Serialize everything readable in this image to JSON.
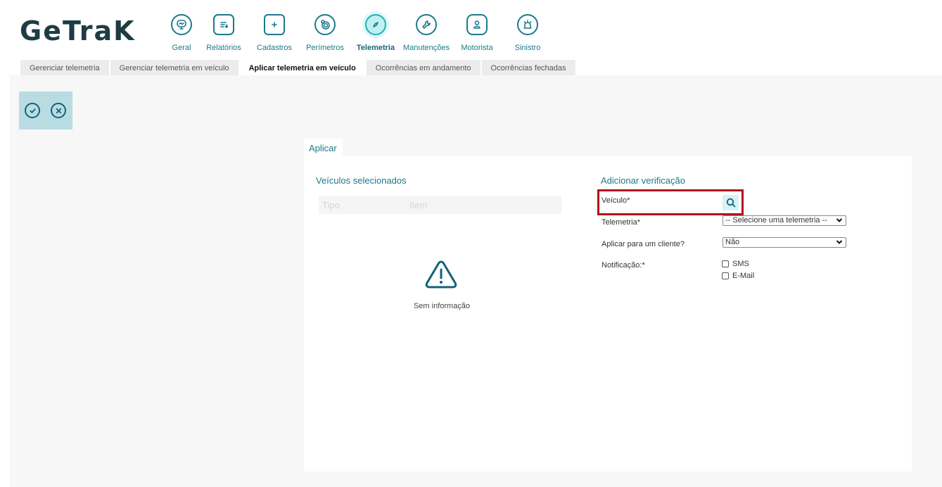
{
  "app": {
    "logo_text": "GeTraK"
  },
  "nav": {
    "items": [
      {
        "label": "Geral",
        "icon": "monitor-chart-icon"
      },
      {
        "label": "Relatórios",
        "icon": "report-list-icon"
      },
      {
        "label": "Cadastros",
        "icon": "folder-plus-icon"
      },
      {
        "label": "Perímetros",
        "icon": "target-perimeter-icon"
      },
      {
        "label": "Telemetria",
        "icon": "compass-icon",
        "active": true
      },
      {
        "label": "Manutenções",
        "icon": "wrench-icon"
      },
      {
        "label": "Motorista",
        "icon": "driver-icon"
      },
      {
        "label": "Sinistro",
        "icon": "alarm-siren-icon"
      }
    ]
  },
  "tabs": [
    {
      "label": "Gerenciar telemetria"
    },
    {
      "label": "Gerenciar telemetria em veículo"
    },
    {
      "label": "Aplicar telemetria em veículo",
      "active": true
    },
    {
      "label": "Ocorrências em andamento"
    },
    {
      "label": "Ocorrências fechadas"
    }
  ],
  "actions": {
    "confirm_icon": "check-circle-icon",
    "cancel_icon": "close-circle-icon"
  },
  "panel": {
    "tab_label": "Aplicar",
    "left": {
      "title": "Veículos selecionados",
      "columns": [
        "Tipo",
        "Item"
      ],
      "empty_text": "Sem informação",
      "empty_icon": "warning-triangle-icon"
    },
    "right": {
      "title": "Adicionar verificação",
      "veiculo_label": "Veículo*",
      "telemetria_label": "Telemetria*",
      "telemetria_value": "-- Selecione uma telemetria --",
      "cliente_label": "Aplicar para um cliente?",
      "cliente_value": "Não",
      "notificacao_label": "Notificação:*",
      "options": [
        "SMS",
        "E-Mail"
      ]
    }
  },
  "colors": {
    "accent": "#1b7a8c",
    "highlight": "#b0141c",
    "actionbar": "#b9dce3"
  }
}
